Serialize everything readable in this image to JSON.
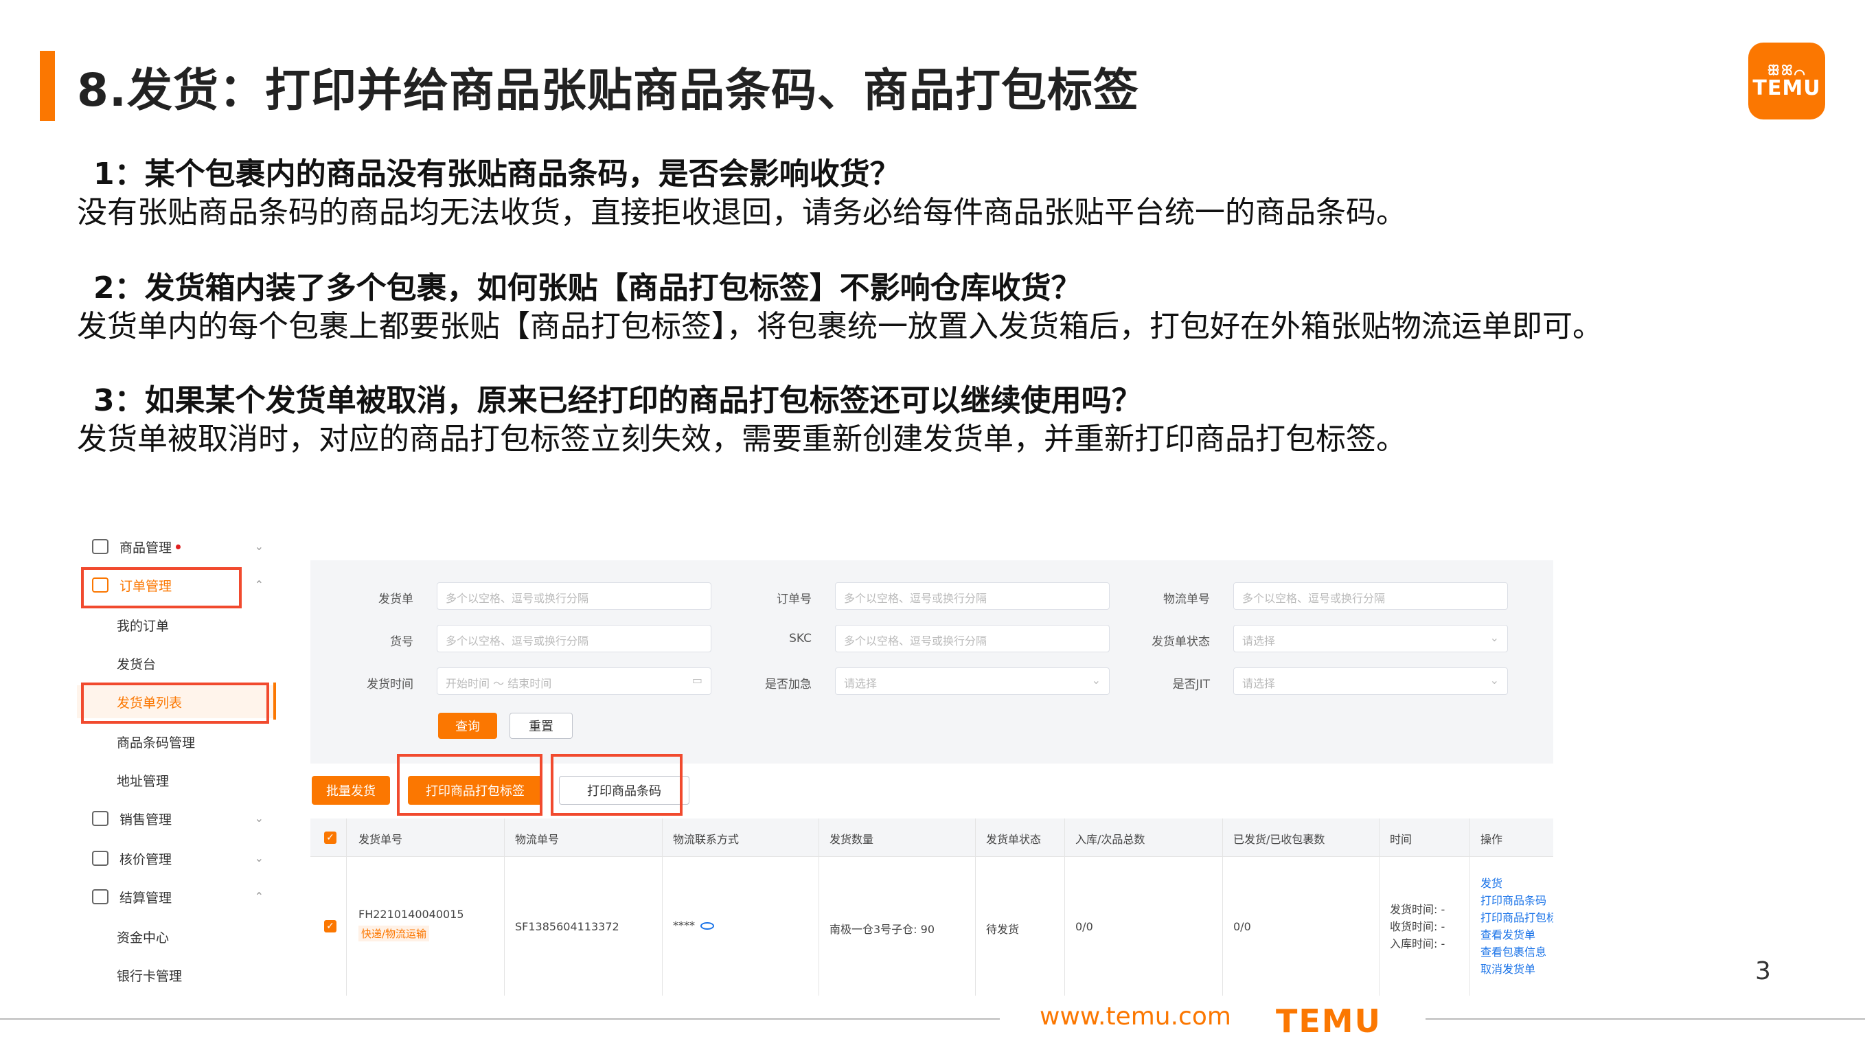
{
  "slide": {
    "title": "8.发货：打印并给商品张贴商品条码、商品打包标签",
    "page_number": "3",
    "accent_color": "#fb7701"
  },
  "brand": {
    "logo_glyphs": "ꕥꕤ⌒",
    "logo_word": "TEMU",
    "footer_url": "www.temu.com",
    "footer_brand": "TEMU"
  },
  "qa": [
    {
      "q": "1：某个包裹内的商品没有张贴商品条码，是否会影响收货？",
      "a": "没有张贴商品条码的商品均无法收货，直接拒收退回，请务必给每件商品张贴平台统一的商品条码。"
    },
    {
      "q": "2：发货箱内装了多个包裹，如何张贴【商品打包标签】不影响仓库收货？",
      "a": "发货单内的每个包裹上都要张贴【商品打包标签】，将包裹统一放置入发货箱后，打包好在外箱张贴物流运单即可。"
    },
    {
      "q": "3：如果某个发货单被取消，原来已经打印的商品打包标签还可以继续使用吗？",
      "a": "发货单被取消时，对应的商品打包标签立刻失效，需要重新创建发货单，并重新打印商品打包标签。"
    }
  ],
  "screenshot": {
    "sidebar": {
      "items": [
        {
          "label": "商品管理",
          "icon": "box-icon"
        },
        {
          "label": "订单管理",
          "icon": "order-icon"
        },
        {
          "label": "我的订单"
        },
        {
          "label": "发货台"
        },
        {
          "label": "发货单列表"
        },
        {
          "label": "商品条码管理"
        },
        {
          "label": "地址管理"
        },
        {
          "label": "销售管理",
          "icon": "chart-icon"
        },
        {
          "label": "核价管理",
          "icon": "price-icon"
        },
        {
          "label": "结算管理",
          "icon": "wallet-icon"
        },
        {
          "label": "资金中心"
        },
        {
          "label": "银行卡管理"
        }
      ]
    },
    "filters": {
      "ship_no_label": "发货单",
      "ship_no_placeholder": "多个以空格、逗号或换行分隔",
      "order_no_label": "订单号",
      "order_no_placeholder": "多个以空格、逗号或换行分隔",
      "logistics_no_label": "物流单号",
      "logistics_no_placeholder": "多个以空格、逗号或换行分隔",
      "sku_label": "货号",
      "sku_placeholder": "多个以空格、逗号或换行分隔",
      "skc_label": "SKC",
      "skc_placeholder": "多个以空格、逗号或换行分隔",
      "status_label": "发货单状态",
      "status_placeholder": "请选择",
      "time_label": "发货时间",
      "time_start": "开始时间",
      "time_sep": "～",
      "time_end": "结束时间",
      "urgent_label": "是否加急",
      "urgent_placeholder": "请选择",
      "jit_label": "是否JIT",
      "jit_placeholder": "请选择",
      "search_button": "查询",
      "reset_button": "重置"
    },
    "toolbar": {
      "batch_ship": "批量发货",
      "print_pack_label": "打印商品打包标签",
      "print_barcode": "打印商品条码"
    },
    "table": {
      "headers": [
        "发货单号",
        "物流单号",
        "物流联系方式",
        "发货数量",
        "发货单状态",
        "入库/次品总数",
        "已发货/已收包裹数",
        "时间",
        "操作"
      ],
      "row": {
        "ship_no": "FH2210140040015",
        "ship_tag": "快递/物流运输",
        "logistics_no": "SF1385604113372",
        "contact": "****",
        "qty": "南极一仓3号子仓: 90",
        "status": "待发货",
        "stock": "0/0",
        "packages": "0/0",
        "time_lines": [
          "发货时间: -",
          "收货时间: -",
          "入库时间: -"
        ],
        "actions": [
          "发货",
          "打印商品条码",
          "打印商品打包标签",
          "查看发货单",
          "查看包裹信息",
          "取消发货单"
        ]
      }
    }
  }
}
